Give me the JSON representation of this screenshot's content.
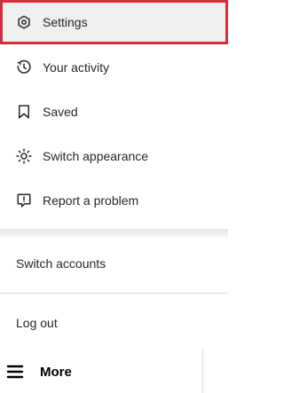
{
  "menu": {
    "items": [
      {
        "label": "Settings",
        "icon": "settings-icon"
      },
      {
        "label": "Your activity",
        "icon": "activity-icon"
      },
      {
        "label": "Saved",
        "icon": "bookmark-icon"
      },
      {
        "label": "Switch appearance",
        "icon": "sun-icon"
      },
      {
        "label": "Report a problem",
        "icon": "report-icon"
      }
    ],
    "switch_accounts": "Switch accounts",
    "log_out": "Log out"
  },
  "bottom": {
    "more_label": "More",
    "more_icon": "hamburger-icon"
  },
  "colors": {
    "highlight_border": "#d32f3a",
    "highlight_bg": "#efefef",
    "text": "#262626",
    "divider": "#dbdbdb"
  }
}
